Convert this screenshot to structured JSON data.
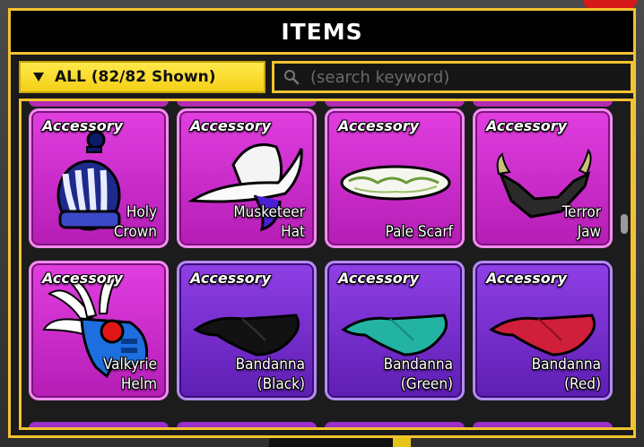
{
  "panel": {
    "title": "ITEMS"
  },
  "filter": {
    "label": "ALL (82/82 Shown)"
  },
  "search": {
    "placeholder": "(search keyword)",
    "value": ""
  },
  "colors": {
    "accent": "#f2c230",
    "card_pink": "#d12ed1",
    "card_purple": "#7a2fd6"
  },
  "items": [
    {
      "category": "Accessory",
      "name_line1": "Holy",
      "name_line2": "Crown",
      "color": "pink",
      "icon": "holy-crown-icon"
    },
    {
      "category": "Accessory",
      "name_line1": "Musketeer",
      "name_line2": "Hat",
      "color": "pink",
      "icon": "musketeer-hat-icon"
    },
    {
      "category": "Accessory",
      "name_line1": "",
      "name_line2": "Pale Scarf",
      "color": "pink",
      "icon": "pale-scarf-icon"
    },
    {
      "category": "Accessory",
      "name_line1": "Terror",
      "name_line2": "Jaw",
      "color": "pink",
      "icon": "terror-jaw-icon"
    },
    {
      "category": "Accessory",
      "name_line1": "Valkyrie",
      "name_line2": "Helm",
      "color": "pink",
      "icon": "valkyrie-helm-icon"
    },
    {
      "category": "Accessory",
      "name_line1": "Bandanna",
      "name_line2": "(Black)",
      "color": "purple",
      "icon": "bandanna-black-icon"
    },
    {
      "category": "Accessory",
      "name_line1": "Bandanna",
      "name_line2": "(Green)",
      "color": "purple",
      "icon": "bandanna-green-icon"
    },
    {
      "category": "Accessory",
      "name_line1": "Bandanna",
      "name_line2": "(Red)",
      "color": "purple",
      "icon": "bandanna-red-icon"
    }
  ]
}
